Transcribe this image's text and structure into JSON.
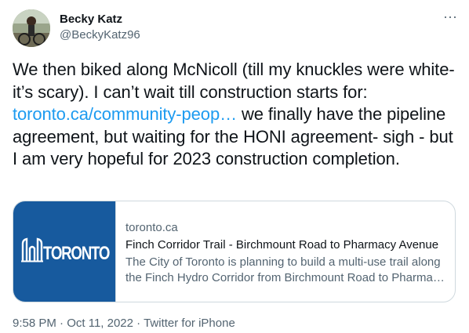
{
  "author": {
    "display_name": "Becky Katz",
    "handle": "@BeckyKatz96"
  },
  "icons": {
    "more": "more-horizontal-icon",
    "avatar": "profile-photo"
  },
  "tweet": {
    "text_before_link": "We then biked along McNicoll (till my knuckles were white- it’s scary). I can’t wait till construction starts for: ",
    "link_text": "toronto.ca/community-peop…",
    "text_after_link": " we finally have the pipeline agreement, but waiting for the HONI agreement- sigh - but I am very hopeful for 2023 construction completion."
  },
  "card": {
    "logo_text": "TORONTO",
    "domain": "toronto.ca",
    "title": "Finch Corridor Trail - Birchmount Road to Pharmacy Avenue",
    "description_line1": "The City of Toronto is planning to build a multi-use trail along",
    "description_line2": "the Finch Hydro Corridor from Birchmount Road to Pharma…"
  },
  "meta": {
    "time": "9:58 PM",
    "separator": "·",
    "date": "Oct 11, 2022",
    "source": "Twitter for iPhone"
  },
  "colors": {
    "link": "#1d9bf0",
    "text": "#0f1419",
    "secondary": "#536471",
    "card_border": "#cfd9de",
    "toronto_blue": "#175a9e"
  }
}
